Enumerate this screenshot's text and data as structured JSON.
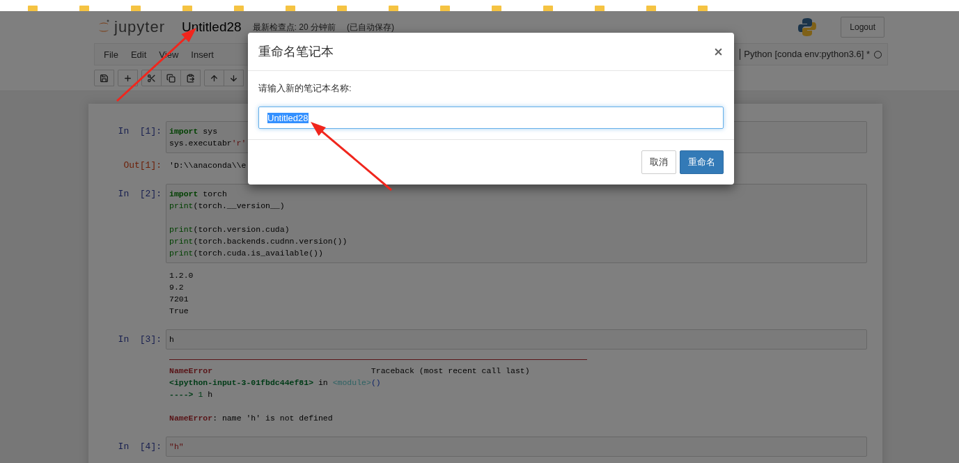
{
  "header": {
    "logo_text": "jupyter",
    "notebook_name": "Untitled28",
    "checkpoint": "最新检查点: 20 分钟前",
    "autosave": "(已自动保存)",
    "logout": "Logout"
  },
  "menubar": {
    "items": [
      "File",
      "Edit",
      "View",
      "Insert"
    ],
    "kernel": "Python [conda env:python3.6] *",
    "kernel_busy": false
  },
  "toolbar": {
    "groups": [
      [
        {
          "kind": "save"
        }
      ],
      [
        {
          "kind": "add"
        }
      ],
      [
        {
          "kind": "cut"
        },
        {
          "kind": "copy"
        },
        {
          "kind": "paste"
        }
      ],
      [
        {
          "kind": "up"
        },
        {
          "kind": "down"
        }
      ]
    ]
  },
  "cells": [
    {
      "kind": "code",
      "prompt": "In  [1]:",
      "lines": [
        [
          {
            "kind": "keyword",
            "text": "import"
          },
          {
            "kind": "plain",
            "text": " sys"
          }
        ],
        [
          {
            "kind": "plain",
            "text": "sys.executabr"
          },
          {
            "kind": "string",
            "text": "'r'"
          }
        ]
      ]
    },
    {
      "kind": "result",
      "prompt": "Out[1]:",
      "lines": [
        [
          {
            "kind": "plain",
            "text": "'D:\\\\anaconda\\\\e"
          }
        ]
      ]
    },
    {
      "kind": "code",
      "prompt": "In  [2]:",
      "lines": [
        [
          {
            "kind": "keyword",
            "text": "import"
          },
          {
            "kind": "plain",
            "text": " torch"
          }
        ],
        [
          {
            "kind": "builtin",
            "text": "print"
          },
          {
            "kind": "plain",
            "text": "(torch.__version__)"
          }
        ],
        [
          {
            "kind": "blank"
          }
        ],
        [
          {
            "kind": "builtin",
            "text": "print"
          },
          {
            "kind": "plain",
            "text": "(torch.version.cuda)"
          }
        ],
        [
          {
            "kind": "builtin",
            "text": "print"
          },
          {
            "kind": "plain",
            "text": "(torch.backends.cudnn.version())"
          }
        ],
        [
          {
            "kind": "builtin",
            "text": "print"
          },
          {
            "kind": "plain",
            "text": "(torch.cuda.is_available())"
          }
        ]
      ]
    },
    {
      "kind": "stream",
      "lines": [
        [
          {
            "kind": "plain",
            "text": "1.2.0"
          }
        ],
        [
          {
            "kind": "plain",
            "text": "9.2"
          }
        ],
        [
          {
            "kind": "plain",
            "text": "7201"
          }
        ],
        [
          {
            "kind": "plain",
            "text": "True"
          }
        ]
      ]
    },
    {
      "kind": "code",
      "prompt": "In  [3]:",
      "lines": [
        [
          {
            "kind": "plain",
            "text": "h"
          }
        ]
      ]
    },
    {
      "kind": "error",
      "lines": [
        [
          {
            "kind": "error",
            "text": "NameError"
          },
          {
            "kind": "plain",
            "text": "                                 Traceback (most recent call last)"
          }
        ],
        [
          {
            "kind": "location",
            "text": "<ipython-input-3-01fbdc44ef81>"
          },
          {
            "kind": "plain",
            "text": " in "
          },
          {
            "kind": "module",
            "text": "<module>"
          },
          {
            "kind": "paren",
            "text": "()"
          }
        ],
        [
          {
            "kind": "location",
            "text": "---->"
          },
          {
            "kind": "lineno",
            "text": " 1"
          },
          {
            "kind": "plain",
            "text": " h"
          }
        ],
        [
          {
            "kind": "blank"
          }
        ],
        [
          {
            "kind": "error",
            "text": "NameError"
          },
          {
            "kind": "plain",
            "text": ": name 'h' is not defined"
          }
        ]
      ]
    },
    {
      "kind": "code",
      "prompt": "In  [4]:",
      "lines": [
        [
          {
            "kind": "string",
            "text": "\"h\""
          }
        ]
      ]
    }
  ],
  "dialog": {
    "title": "重命名笔记本",
    "label": "请输入新的笔记本名称:",
    "value": "Untitled28",
    "value_selected": true,
    "buttons": [
      {
        "label": "取消",
        "kind": "default"
      },
      {
        "label": "重命名",
        "kind": "primary"
      }
    ]
  },
  "annotations": [
    {
      "kind": "arrow"
    },
    {
      "kind": "arrow"
    }
  ]
}
